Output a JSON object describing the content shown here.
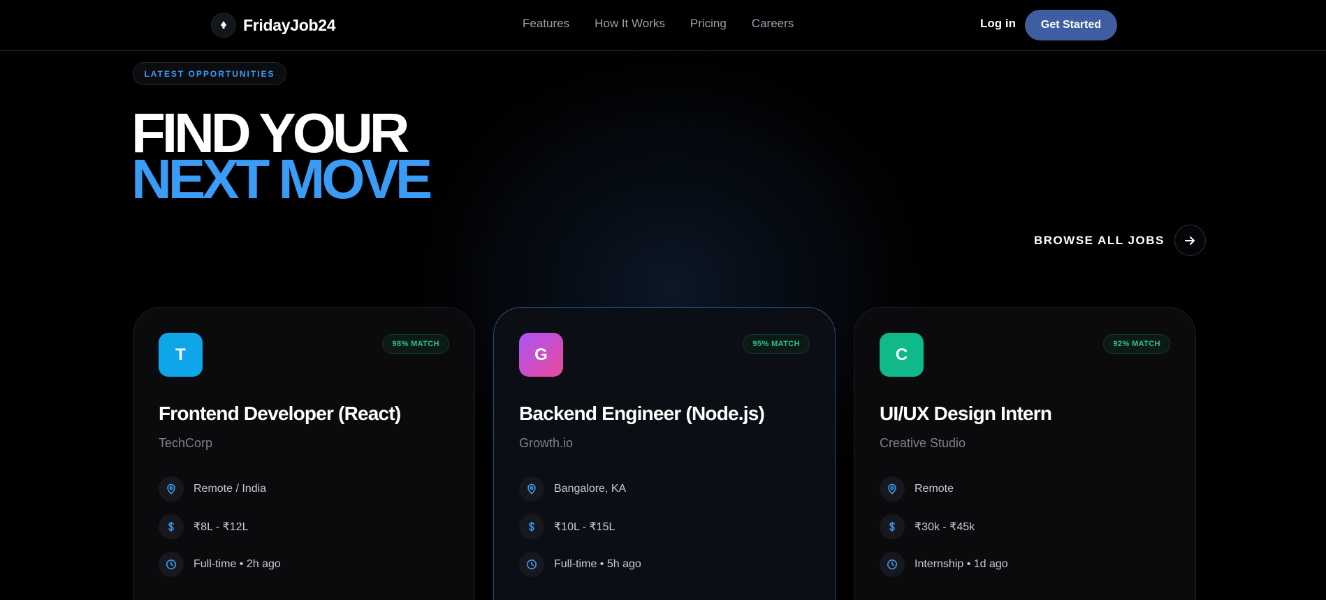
{
  "brand": {
    "name": "FridayJob24",
    "icon": "rocket-icon"
  },
  "nav": {
    "links": [
      "Features",
      "How It Works",
      "Pricing",
      "Careers"
    ],
    "login_label": "Log in",
    "cta_label": "Get Started"
  },
  "hero": {
    "badge": "LATEST OPPORTUNITIES",
    "title_line1": "FIND YOUR",
    "title_line2": "NEXT MOVE",
    "browse_label": "BROWSE ALL JOBS"
  },
  "colors": {
    "accent": "#3b9cf5",
    "cta": "#3f5ea1",
    "match": "#2ec28f"
  },
  "jobs": [
    {
      "logo_letter": "T",
      "logo_color": "#0ea5e9",
      "match": "98% MATCH",
      "title": "Frontend Developer (React)",
      "company": "TechCorp",
      "location": "Remote / India",
      "salary": "₹8L - ₹12L",
      "type": "Full-time • 2h ago"
    },
    {
      "logo_letter": "G",
      "logo_color": "#c14bd8",
      "match": "95% MATCH",
      "title": "Backend Engineer (Node.js)",
      "company": "Growth.io",
      "location": "Bangalore, KA",
      "salary": "₹10L - ₹15L",
      "type": "Full-time • 5h ago"
    },
    {
      "logo_letter": "C",
      "logo_color": "#10b98a",
      "match": "92% MATCH",
      "title": "UI/UX Design Intern",
      "company": "Creative Studio",
      "location": "Remote",
      "salary": "₹30k - ₹45k",
      "type": "Internship • 1d ago"
    }
  ]
}
